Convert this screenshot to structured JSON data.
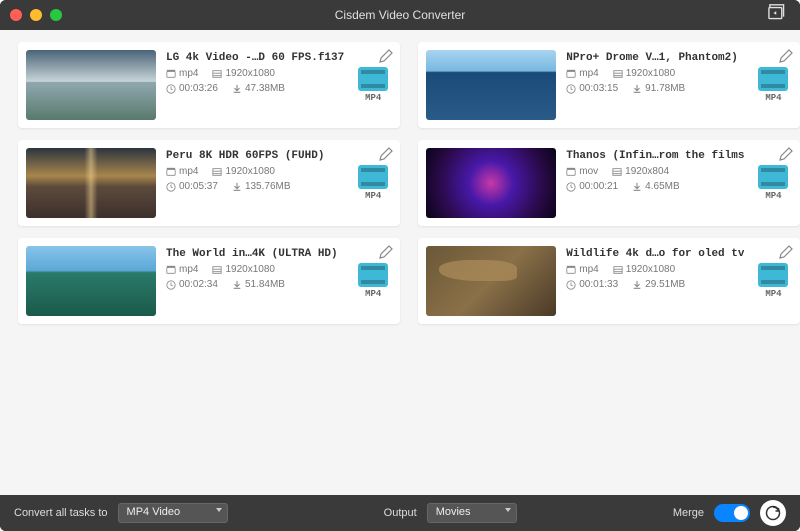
{
  "app": {
    "title": "Cisdem Video Converter"
  },
  "videos": [
    {
      "title": "LG 4k Video -…D 60 FPS.f137",
      "format": "mp4",
      "resolution": "1920x1080",
      "duration": "00:03:26",
      "size": "47.38MB",
      "out_label": "MP4",
      "thumb_class": "t0"
    },
    {
      "title": "NPro+ Drome V…1, Phantom2)",
      "format": "mp4",
      "resolution": "1920x1080",
      "duration": "00:03:15",
      "size": "91.78MB",
      "out_label": "MP4",
      "thumb_class": "t3"
    },
    {
      "title": "Peru 8K HDR 60FPS (FUHD)",
      "format": "mp4",
      "resolution": "1920x1080",
      "duration": "00:05:37",
      "size": "135.76MB",
      "out_label": "MP4",
      "thumb_class": "t1"
    },
    {
      "title": "Thanos (Infin…rom the films",
      "format": "mov",
      "resolution": "1920x804",
      "duration": "00:00:21",
      "size": "4.65MB",
      "out_label": "MP4",
      "thumb_class": "t4"
    },
    {
      "title": "The World in…4K (ULTRA HD)",
      "format": "mp4",
      "resolution": "1920x1080",
      "duration": "00:02:34",
      "size": "51.84MB",
      "out_label": "MP4",
      "thumb_class": "t2"
    },
    {
      "title": "Wildlife 4k d…o for oled tv",
      "format": "mp4",
      "resolution": "1920x1080",
      "duration": "00:01:33",
      "size": "29.51MB",
      "out_label": "MP4",
      "thumb_class": "t5"
    }
  ],
  "bottombar": {
    "convert_label": "Convert all tasks to",
    "format_select": "MP4 Video",
    "output_label": "Output",
    "output_select": "Movies",
    "merge_label": "Merge",
    "merge_on": true
  }
}
